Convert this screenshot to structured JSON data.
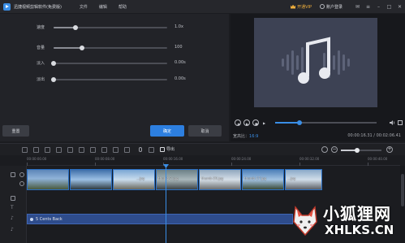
{
  "titlebar": {
    "app_title": "迅捷视频剪辑软件(免费版)",
    "menu": [
      "文件",
      "编辑",
      "帮助"
    ],
    "vip_label": "开通VIP",
    "login_label": "账户登录"
  },
  "settings": {
    "sliders": [
      {
        "label": "速度",
        "value": "1.0x",
        "fraction": 0.19
      },
      {
        "label": "音量",
        "value": "100",
        "fraction": 0.25
      },
      {
        "label": "淡入",
        "value": "0.00s",
        "fraction": 0.0
      },
      {
        "label": "淡出",
        "value": "0.00s",
        "fraction": 0.0
      }
    ],
    "reset_label": "重置",
    "ok_label": "确定",
    "cancel_label": "取消"
  },
  "preview": {
    "ratio_label": "宽高比：",
    "ratio_value": "16:9",
    "timecode": "00:00:16.31 / 00:02:06.41",
    "progress_fraction": 0.24
  },
  "toolbar": {
    "export_label": "导出",
    "zoom_fraction": 0.4
  },
  "timeline": {
    "ruler_labels": [
      "00:00:00.00",
      "00:00:08.00",
      "00:00:16.00",
      "00:00:24.00",
      "00:00:32.00",
      "00:00:40.00",
      "00:00:48.00"
    ],
    "clips": [
      {
        "label": ""
      },
      {
        "label": ""
      },
      {
        "label": "...jpg"
      },
      {
        "label": "thumb-2.jpg"
      },
      {
        "label": "thumb-20.jpg"
      },
      {
        "label": "thumb-17.jpg"
      },
      {
        "label": "...jpg"
      }
    ],
    "audio_label": "5 Cents Back"
  },
  "watermark": {
    "title": "小狐狸网",
    "url": "XHLKS.CN"
  },
  "colors": {
    "accent": "#3a8ee6",
    "vip": "#f2b03d",
    "audio_track": "#2e4c8c"
  }
}
